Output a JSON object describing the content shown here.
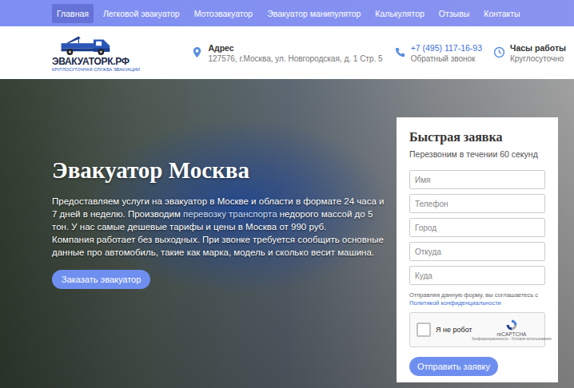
{
  "nav": [
    {
      "label": "Главная",
      "selected": true
    },
    {
      "label": "Легковой эвакуатор",
      "selected": false
    },
    {
      "label": "Мотоэвакуатор",
      "selected": false
    },
    {
      "label": "Эвакуатор манипулятор",
      "selected": false
    },
    {
      "label": "Калькулятор",
      "selected": false
    },
    {
      "label": "Отзывы",
      "selected": false
    },
    {
      "label": "Контакты",
      "selected": false
    }
  ],
  "logo": {
    "title": "ЭВАКУАТОРК.РФ",
    "subtitle": "КРУГЛОСУТОЧНАЯ СЛУЖБА ЭВАКУАЦИИ"
  },
  "contacts": [
    {
      "kind": "address",
      "title": "Адрес",
      "text": "127576, г.Москва, ул. Новгородская, д. 1 Стр. 5"
    },
    {
      "kind": "phone",
      "title": "+7 (495) 117-16-93",
      "text": "Обратный звонок"
    },
    {
      "kind": "hours",
      "title": "Часы работы",
      "text": "Круглосуточно"
    }
  ],
  "hero": {
    "title": "Эвакуатор Москва",
    "paragraphs": [
      [
        {
          "text": "Предоставляем услуги на эвакуатор в Москве и области в формате 24 часа и 7 дней в неделю. Производим ",
          "link": false
        },
        {
          "text": "перевозку транспорта",
          "link": true
        },
        {
          "text": " недорого массой до 5 тон. У нас самые дешевые тарифы и цены в Москва от 990 руб.",
          "link": false
        }
      ],
      [
        {
          "text": "Компания работает без выходных. При звонке требуется сообщить основные данные про автомобиль, такие как марка, модель и сколько весит машина.",
          "link": false
        }
      ]
    ],
    "button": "Заказать эвакуатор"
  },
  "form": {
    "title": "Быстрая заявка",
    "subtitle": "Перезвоним в течении 60 секунд",
    "fields": [
      {
        "placeholder": "Имя"
      },
      {
        "placeholder": "Телефон"
      },
      {
        "placeholder": "Город"
      },
      {
        "placeholder": "Откуда"
      },
      {
        "placeholder": "Куда"
      }
    ],
    "consent": {
      "text": "Отправляя данную форму, вы соглашаетесь с",
      "link": "Политикой конфиденциальности"
    },
    "captcha": {
      "checked": false,
      "label": "Я не робот",
      "brand": "reCAPTCHA",
      "terms": "Конфиденциальность - Условия использования"
    },
    "submit": "Отправить заявку"
  }
}
